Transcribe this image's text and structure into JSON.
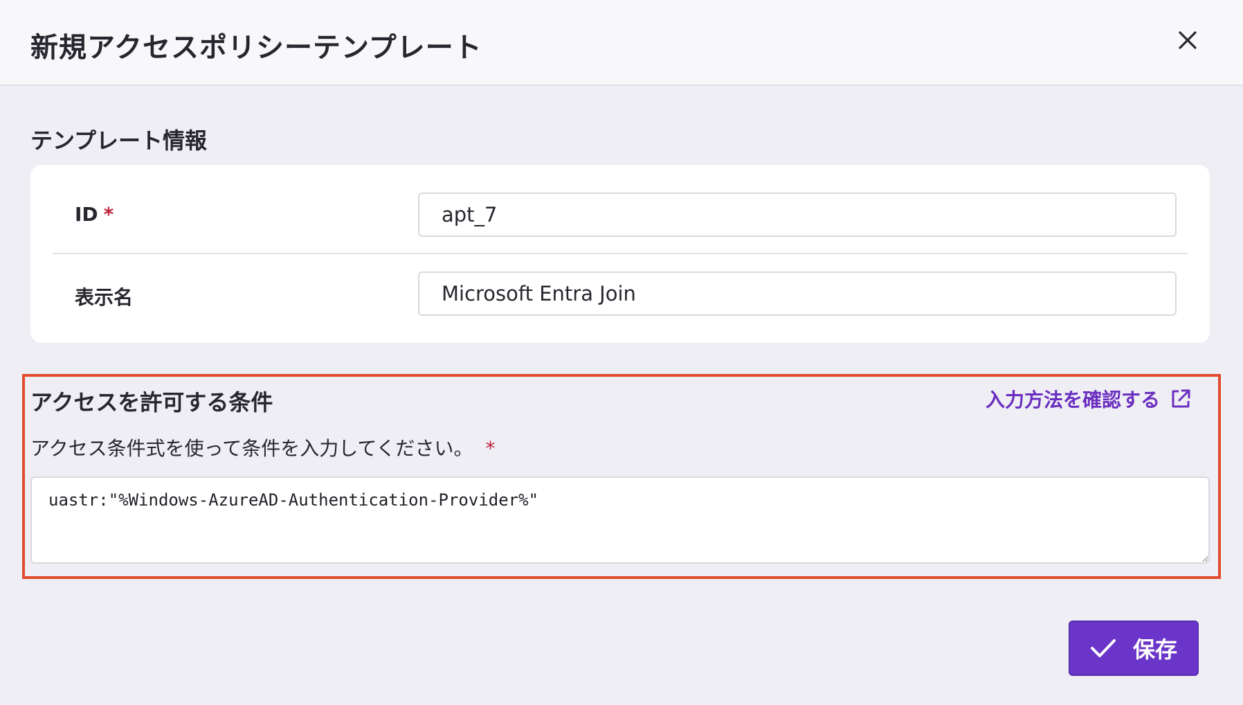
{
  "dialog": {
    "title": "新規アクセスポリシーテンプレート",
    "close_icon": "close-icon"
  },
  "template_info": {
    "section_title": "テンプレート情報",
    "id_label": "ID",
    "required_mark": "*",
    "id_value": "apt_7",
    "display_name_label": "表示名",
    "display_name_value": "Microsoft Entra Join"
  },
  "access_conditions": {
    "section_title": "アクセスを許可する条件",
    "help_link_label": "入力方法を確認する",
    "help_link_icon": "external-link-icon",
    "hint": "アクセス条件式を使って条件を入力してください。",
    "required_mark": "*",
    "expression": "uastr:\"%Windows-AzureAD-Authentication-Provider%\""
  },
  "footer": {
    "save_label": "保存",
    "save_icon": "check-icon"
  },
  "colors": {
    "accent": "#6a35c8",
    "link": "#6a2fc0",
    "required": "#c0223c",
    "highlight_border": "#e24a2e",
    "background": "#efeef4"
  }
}
